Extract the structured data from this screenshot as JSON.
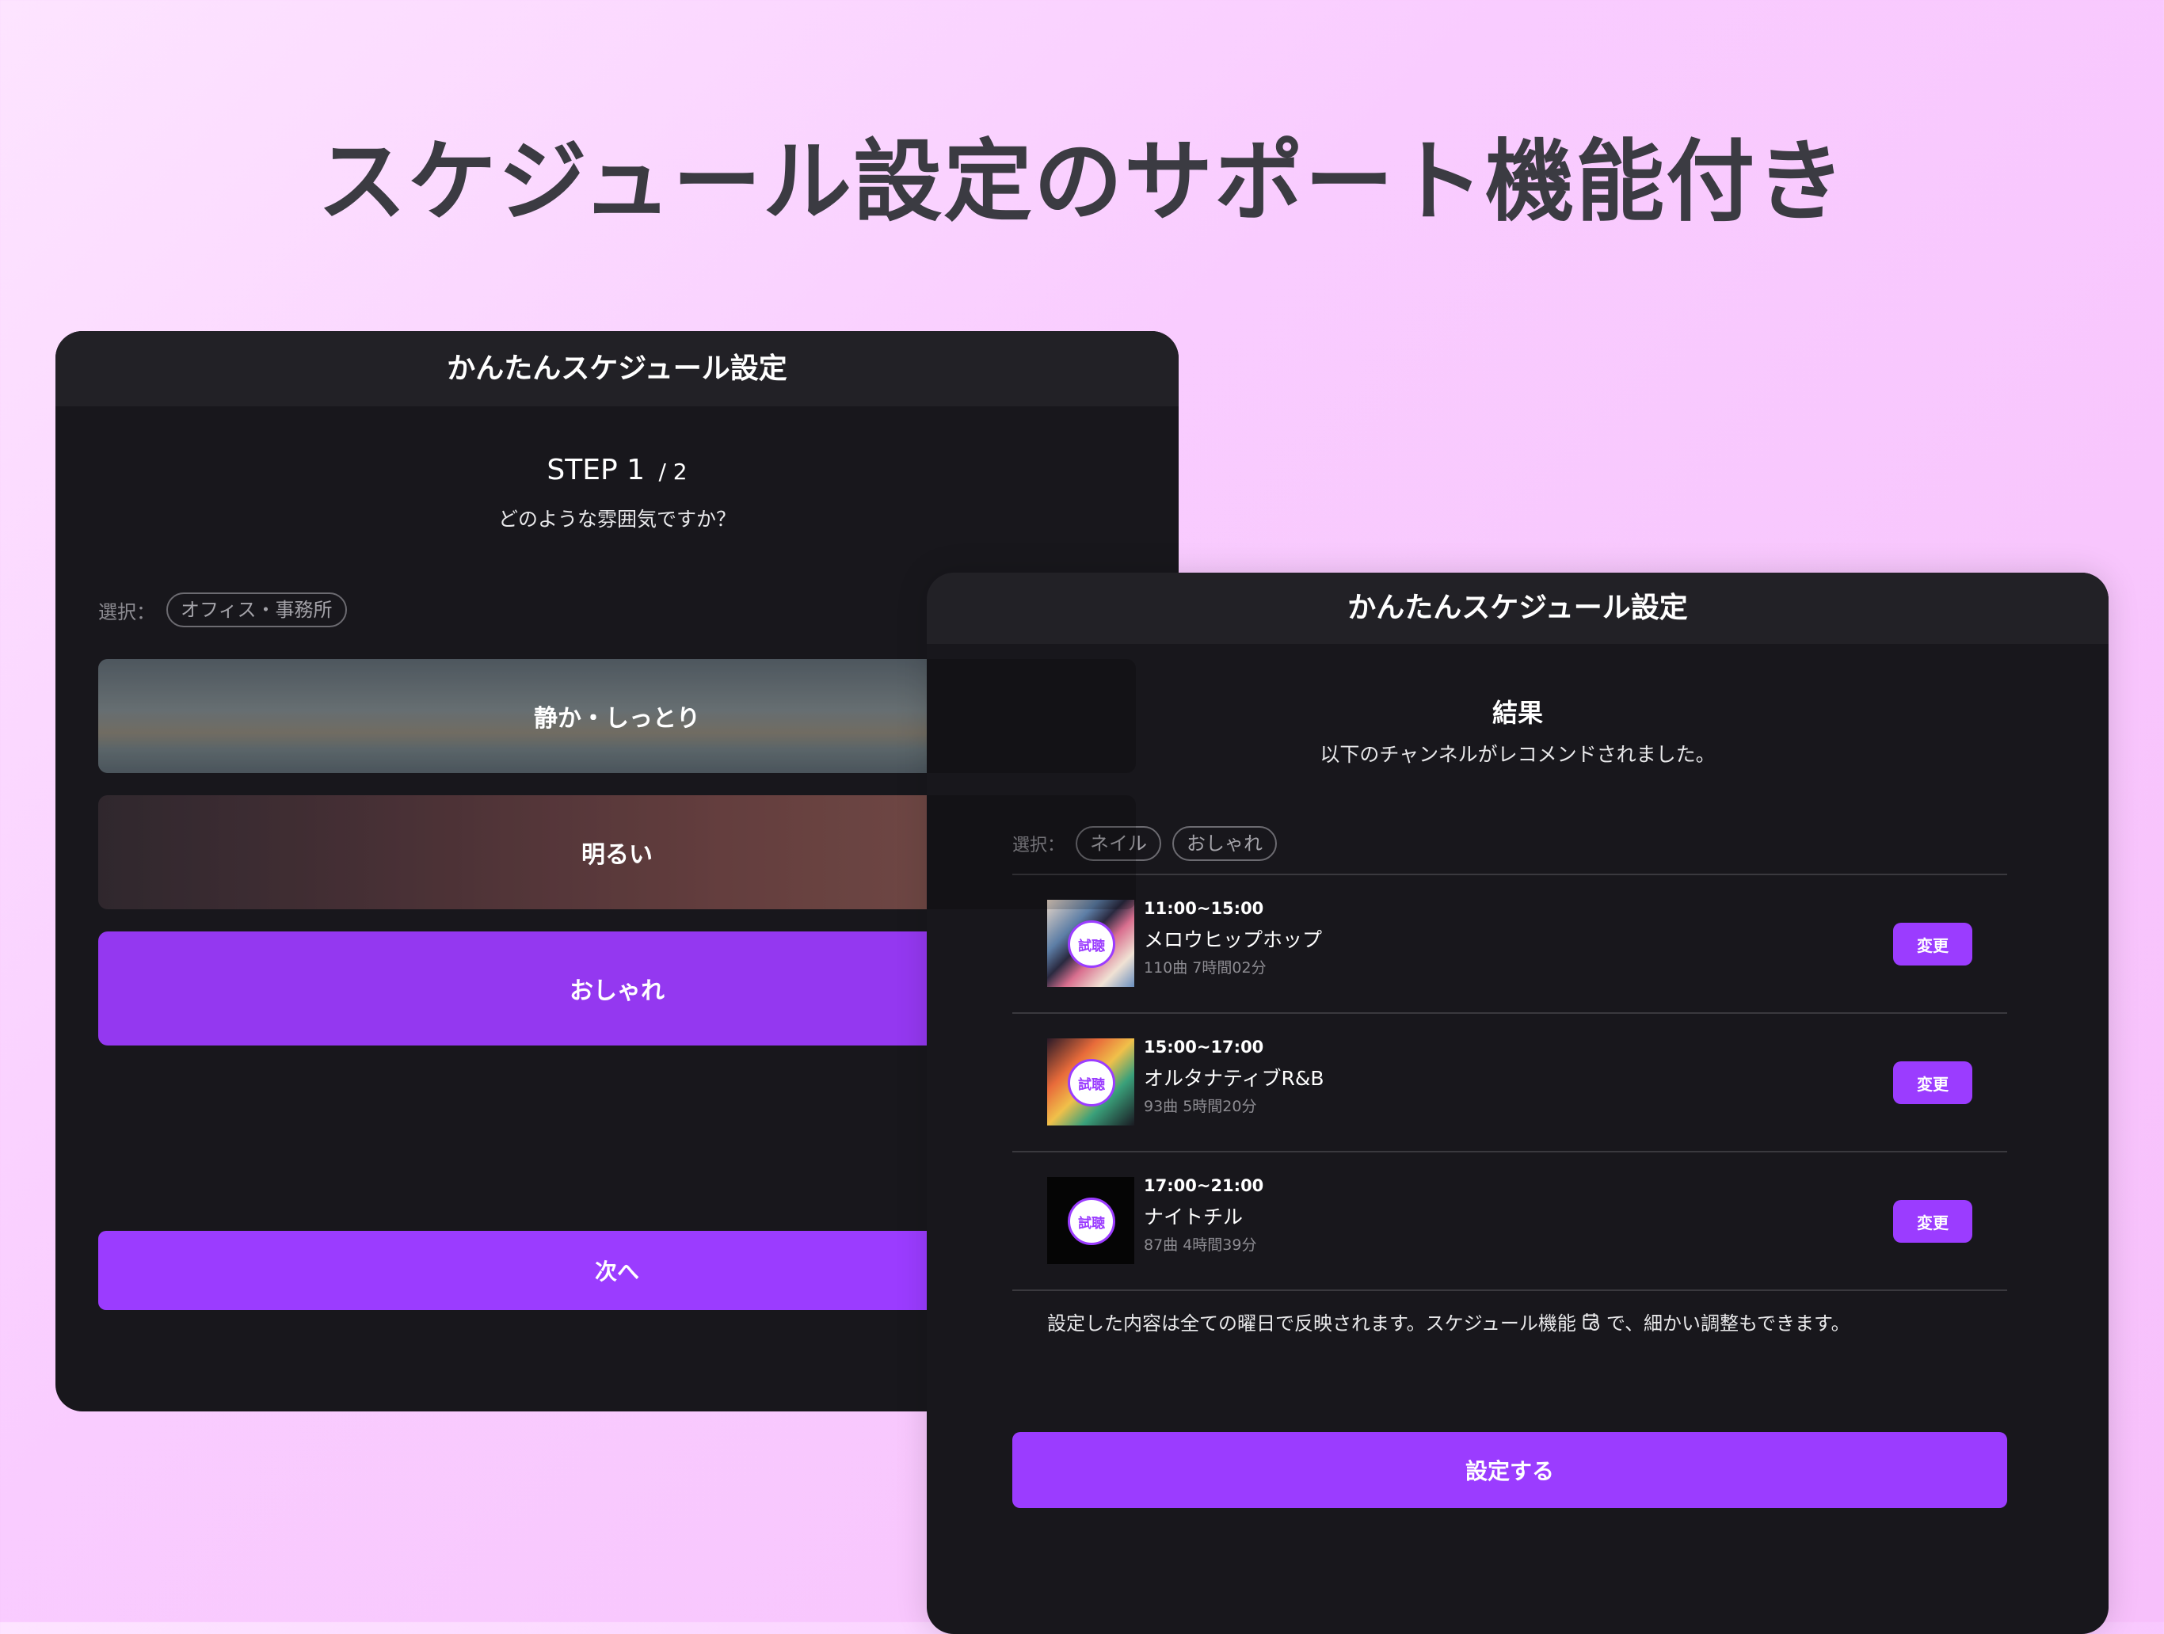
{
  "headline": "スケジュール設定のサポート機能付き",
  "panel1": {
    "title": "かんたんスケジュール設定",
    "step_label": "STEP 1",
    "step_total": "/ 2",
    "question": "どのような雰囲気ですか？",
    "selection_label": "選択：",
    "selection_chip": "オフィス・事務所",
    "options": [
      {
        "label": "静か・しっとり"
      },
      {
        "label": "明るい"
      },
      {
        "label": "おしゃれ"
      }
    ],
    "next_label": "次へ"
  },
  "panel2": {
    "title": "かんたんスケジュール設定",
    "result_title": "結果",
    "result_subtitle": "以下のチャンネルがレコメンドされました。",
    "selection_label": "選択：",
    "selection_chips": [
      "ネイル",
      "おしゃれ"
    ],
    "preview_badge": "試聴",
    "items": [
      {
        "time": "11:00~15:00",
        "name": "メロウヒップホップ",
        "meta": "110曲 7時間02分",
        "change_label": "変更"
      },
      {
        "time": "15:00~17:00",
        "name": "オルタナティブR&B",
        "meta": "93曲 5時間20分",
        "change_label": "変更"
      },
      {
        "time": "17:00~21:00",
        "name": "ナイトチル",
        "meta": "87曲 4時間39分",
        "change_label": "変更"
      }
    ],
    "note_before": "設定した内容は全ての曜日で反映されます。スケジュール機能",
    "note_after": "で、細かい調整もできます。",
    "submit_label": "設定する"
  },
  "colors": {
    "accent": "#9b3cff",
    "panel_bg": "#18171c",
    "header_bg": "#222126"
  },
  "icons": {
    "calendar": "calendar-clock-icon"
  }
}
